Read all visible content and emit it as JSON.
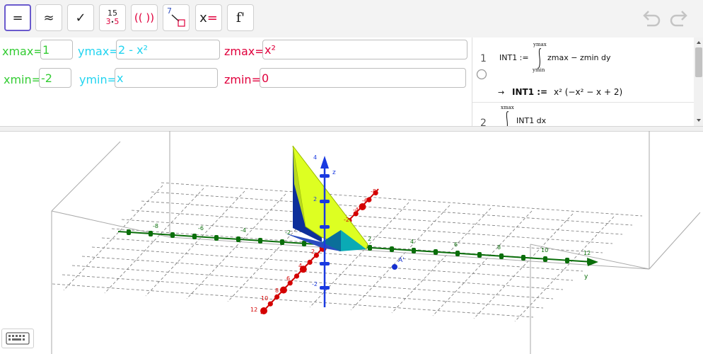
{
  "toolbar": {
    "buttons": [
      {
        "name": "equals-mode-button",
        "label": "="
      },
      {
        "name": "approx-mode-button",
        "label": "≈"
      },
      {
        "name": "check-mode-button",
        "label": "✓"
      },
      {
        "name": "factor-mode-button",
        "top": "15",
        "bottom_left": "3",
        "bottom_dot": "•",
        "bottom_right": "5"
      },
      {
        "name": "expand-mode-button",
        "label": "(( ))"
      },
      {
        "name": "substitute-mode-button",
        "label": "7"
      },
      {
        "name": "solve-mode-button",
        "label_x": "x",
        "label_eq": "="
      },
      {
        "name": "derivative-mode-button",
        "label": "f'"
      }
    ]
  },
  "inputs": {
    "xmax": {
      "label": "xmax=",
      "value": "1"
    },
    "ymax": {
      "label": "ymax=",
      "value": "2 - x²"
    },
    "zmax": {
      "label": "zmax=",
      "value": "x²"
    },
    "xmin": {
      "label": "xmin=",
      "value": "-2"
    },
    "ymin": {
      "label": "ymin=",
      "value": "x"
    },
    "zmin": {
      "label": "zmin=",
      "value": "0"
    }
  },
  "algebra": {
    "row1": {
      "number": "1",
      "name": "INT1 :=",
      "upper": "ymax",
      "lower": "ymin",
      "integrand": "zmax − zmin dy",
      "arrow": "→",
      "result_name": "INT1 :=",
      "result_expr": "x² (−x² − x + 2)"
    },
    "row2": {
      "number": "2",
      "upper": "xmax",
      "integrand": "INT1 dx"
    }
  },
  "view3d": {
    "point_label": "A'",
    "axis_z": "z",
    "axis_y": "y",
    "z_ticks": [
      "4",
      "2",
      "-2"
    ],
    "y_ticks": [
      "2",
      "4",
      "6",
      "8",
      "10",
      "12"
    ],
    "y_neg_ticks": [
      "-2",
      "-4",
      "-6",
      "-8"
    ],
    "x_ticks": [
      "2",
      "4",
      "6",
      "8",
      "10",
      "12"
    ],
    "x_neg_ticks": [
      "-2",
      "-4",
      "-6",
      "-8"
    ]
  },
  "colors": {
    "accent": "#6a5acd",
    "green": "#33cc33",
    "cyan": "#22d4f0",
    "red": "#e0003c",
    "yellow_surface": "#ddff22",
    "blue_surface": "#1030a0",
    "teal_surface": "#00a0b0"
  }
}
